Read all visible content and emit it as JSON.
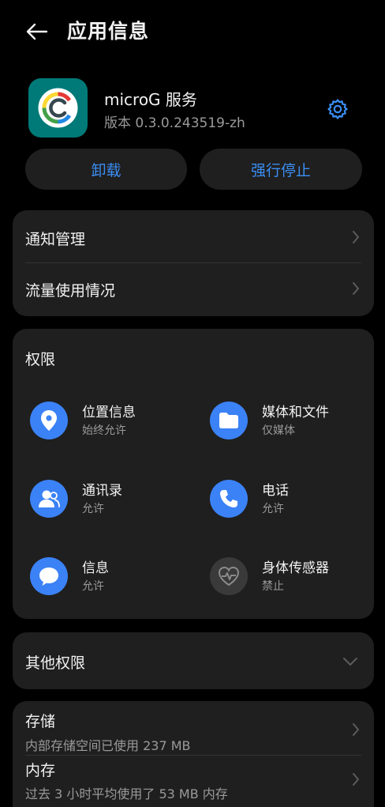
{
  "header": {
    "title": "应用信息",
    "back_icon": "arrow-left-icon"
  },
  "app": {
    "name": "microG 服务",
    "version": "版本 0.3.0.243519-zh",
    "icon": "microg-logo",
    "settings_icon": "gear-icon"
  },
  "actions": {
    "uninstall": "卸载",
    "force_stop": "强行停止"
  },
  "general": {
    "items": [
      {
        "label": "通知管理"
      },
      {
        "label": "流量使用情况"
      }
    ]
  },
  "permissions": {
    "title": "权限",
    "items": [
      {
        "name": "位置信息",
        "status": "始终允许",
        "icon": "location-pin-icon",
        "enabled": true
      },
      {
        "name": "媒体和文件",
        "status": "仅媒体",
        "icon": "folder-icon",
        "enabled": true
      },
      {
        "name": "通讯录",
        "status": "允许",
        "icon": "contacts-icon",
        "enabled": true
      },
      {
        "name": "电话",
        "status": "允许",
        "icon": "phone-icon",
        "enabled": true
      },
      {
        "name": "信息",
        "status": "允许",
        "icon": "message-icon",
        "enabled": true
      },
      {
        "name": "身体传感器",
        "status": "禁止",
        "icon": "heart-rate-icon",
        "enabled": false
      }
    ]
  },
  "other_permissions": {
    "label": "其他权限"
  },
  "storage": {
    "storage_label": "存储",
    "storage_detail": "内部存储空间已使用 237 MB",
    "memory_label": "内存",
    "memory_detail": "过去 3 小时平均使用了 53 MB 内存"
  },
  "colors": {
    "accent": "#3b8ef3",
    "card": "#1f1f1f",
    "background": "#000000",
    "icon_blue": "#3b82f6",
    "app_icon_bg": "#007a78"
  }
}
